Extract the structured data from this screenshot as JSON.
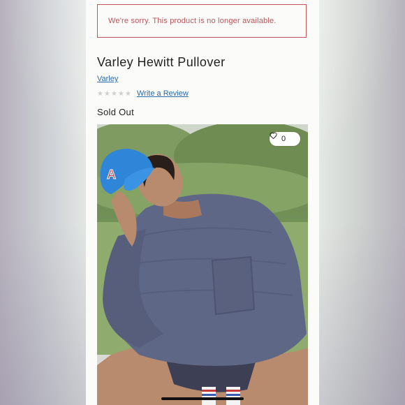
{
  "alert": {
    "message": "We're sorry. This product is no longer available."
  },
  "product": {
    "title": "Varley Hewitt Pullover",
    "brand": "Varley",
    "rating": 0,
    "rating_max": 5,
    "review_link": "Write a Review",
    "status": "Sold Out"
  },
  "image": {
    "like_count": "0",
    "alt_description": "Model sitting cross-legged wearing a blue cap and slate-blue pullover sweater"
  },
  "colors": {
    "alert": "#c0545c",
    "link": "#2a6aa8",
    "sweater": "#5f6787",
    "cap": "#2f86d8"
  }
}
